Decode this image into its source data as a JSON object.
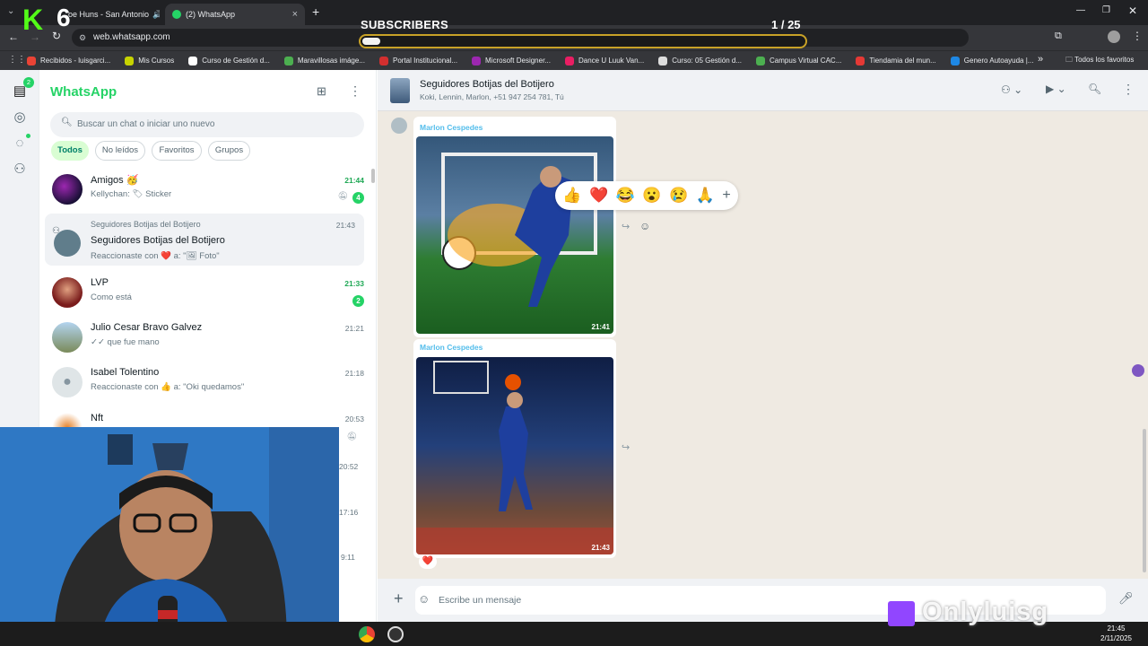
{
  "browser": {
    "tabs": [
      {
        "label": "oe Huns - San Antonio"
      },
      {
        "label": "(2) WhatsApp"
      }
    ],
    "url": "web.whatsapp.com",
    "bookmarks": [
      {
        "label": "Recibidos - luisgarci...",
        "color": "#ea4335"
      },
      {
        "label": "Mis Cursos",
        "color": "#c7d300"
      },
      {
        "label": "Curso de Gestión d...",
        "color": "#ffffff"
      },
      {
        "label": "Maravillosas imáge...",
        "color": "#4caf50"
      },
      {
        "label": "Portal Institucional...",
        "color": "#d32f2f"
      },
      {
        "label": "Microsoft Designer...",
        "color": "#9c27b0"
      },
      {
        "label": "Dance U Luuk Van...",
        "color": "#e91e63"
      },
      {
        "label": "Curso: 05 Gestión d...",
        "color": "#dddddd"
      },
      {
        "label": "Campus Virtual CAC...",
        "color": "#4caf50"
      },
      {
        "label": "Tiendamia del mun...",
        "color": "#e53935"
      },
      {
        "label": "Genero Autoayuda |...",
        "color": "#1e88e5"
      }
    ],
    "all_bookmarks": "Todos los favoritos"
  },
  "overlay": {
    "brand_letter": "K",
    "brand_number": "6",
    "subs_title": "SUBSCRIBERS",
    "subs_count": "1 / 25",
    "subs_progress": 0.04,
    "twitch_name": "Onlyluisg"
  },
  "whatsapp": {
    "title": "WhatsApp",
    "unread_badge": "2",
    "search_placeholder": "Buscar un chat o iniciar uno nuevo",
    "filters": [
      "Todos",
      "No leídos",
      "Favoritos",
      "Grupos"
    ],
    "chats": [
      {
        "name": "Amigos 🥳",
        "preview": "Kellychan: 🏷 Sticker",
        "time": "21:44",
        "unread": "4",
        "muted": true
      },
      {
        "group_header": "Seguidores Botijas del Botijero",
        "name": "Seguidores Botijas del Botijero",
        "preview": "Reaccionaste con ❤️ a: \"🖼 Foto\"",
        "time": "21:43"
      },
      {
        "name": "LVP",
        "preview": "Como está",
        "time": "21:33",
        "unread": "2"
      },
      {
        "name": "Julio Cesar Bravo Galvez",
        "preview": "✓✓ que fue mano",
        "time": "21:21"
      },
      {
        "name": "Isabel Tolentino",
        "preview": "Reaccionaste con 👍 a: \"Oki quedamos\"",
        "time": "21:18"
      },
      {
        "name": "Nft",
        "preview": "",
        "time": "20:53",
        "muted": true
      }
    ],
    "hidden_times": [
      "20:52",
      "17:16",
      "9:11"
    ],
    "conversation": {
      "name": "Seguidores Botijas del Botijero",
      "members": "Koki, Lennin, Marlon, +51 947 254 781, Tú",
      "messages": [
        {
          "sender": "Marlon Cespedes",
          "time": "21:41",
          "kind": "soccer"
        },
        {
          "sender": "Marlon Cespedes",
          "time": "21:43",
          "kind": "basketball"
        }
      ],
      "reactions": [
        "👍",
        "❤️",
        "😂",
        "😮",
        "😢",
        "🙏"
      ],
      "my_reaction": "❤️",
      "composer_placeholder": "Escribe un mensaje"
    }
  },
  "taskbar": {
    "time": "21:45",
    "date": "2/11/2025"
  }
}
